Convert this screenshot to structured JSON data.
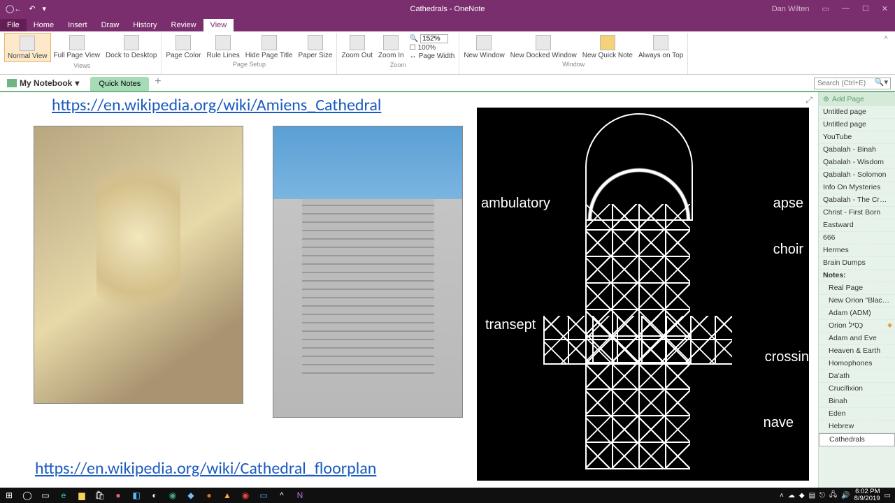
{
  "titlebar": {
    "title": "Cathedrals - OneNote",
    "user": "Dan Wilten"
  },
  "menu": {
    "file": "File",
    "tabs": [
      "Home",
      "Insert",
      "Draw",
      "History",
      "Review",
      "View"
    ],
    "active_index": 5
  },
  "ribbon": {
    "views": {
      "normal": "Normal View",
      "fullpage": "Full Page View",
      "dock": "Dock to Desktop",
      "group": "Views"
    },
    "pagesetup": {
      "pagecolor": "Page Color",
      "rulelines": "Rule Lines",
      "hidetitle": "Hide Page Title",
      "papersize": "Paper Size",
      "group": "Page Setup"
    },
    "zoom": {
      "out": "Zoom Out",
      "in": "Zoom In",
      "pct_value": "152%",
      "pct100": "100%",
      "pagewidth": "Page Width",
      "group": "Zoom"
    },
    "window": {
      "neww": "New Window",
      "docked": "New Docked Window",
      "quick": "New Quick Note",
      "ontop": "Always on Top",
      "group": "Window"
    }
  },
  "notebook": {
    "name": "My Notebook",
    "section": "Quick Notes",
    "search_placeholder": "Search (Ctrl+E)"
  },
  "page": {
    "link1": "https://en.wikipedia.org/wiki/Amiens_Cathedral",
    "link2": "https://en.wikipedia.org/wiki/Cathedral_floorplan",
    "floorplan_labels": {
      "ambulatory": "ambulatory",
      "apse": "apse",
      "choir": "choir",
      "transept": "transept",
      "crossing": "crossin",
      "nave": "nave"
    }
  },
  "pagelist": {
    "add": "Add Page",
    "items": [
      {
        "label": "Untitled page"
      },
      {
        "label": "Untitled page"
      },
      {
        "label": "YouTube"
      },
      {
        "label": "Qabalah - Binah"
      },
      {
        "label": "Qabalah - Wisdom"
      },
      {
        "label": "Qabalah - Solomon"
      },
      {
        "label": "Info On Mysteries"
      },
      {
        "label": "Qabalah - The Crown"
      },
      {
        "label": "Christ - First Born"
      },
      {
        "label": "Eastward"
      },
      {
        "label": "666"
      },
      {
        "label": "Hermes"
      },
      {
        "label": "Brain Dumps"
      },
      {
        "label": "Notes:",
        "bold": true
      },
      {
        "label": "Real Page",
        "indent": true
      },
      {
        "label": "New Orion \"Black Hole\" I",
        "indent": true
      },
      {
        "label": "Adam (ADM)",
        "indent": true
      },
      {
        "label": "Orion כְּסִיל",
        "indent": true,
        "flag": true
      },
      {
        "label": "Adam and Eve",
        "indent": true
      },
      {
        "label": "Heaven & Earth",
        "indent": true
      },
      {
        "label": "Homophones",
        "indent": true
      },
      {
        "label": "Da'ath",
        "indent": true
      },
      {
        "label": "Crucifixion",
        "indent": true
      },
      {
        "label": "Binah",
        "indent": true
      },
      {
        "label": "Eden",
        "indent": true
      },
      {
        "label": "Hebrew",
        "indent": true
      },
      {
        "label": "Cathedrals",
        "indent": true,
        "sel": true
      }
    ]
  },
  "taskbar": {
    "time": "6:02 PM",
    "date": "8/9/2019"
  }
}
